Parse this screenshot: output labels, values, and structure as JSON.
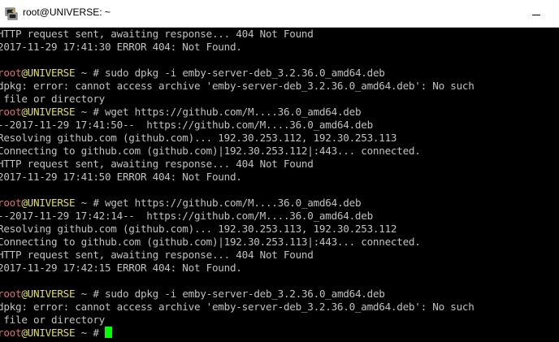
{
  "window": {
    "title": "root@UNIVERSE: ~",
    "icon": "putty-terminal-icon"
  },
  "colors": {
    "background": "#000000",
    "text": "#c0c0c0",
    "prompt_user": "#e06c6c",
    "prompt_host": "#e0e060",
    "cursor": "#00ff00"
  },
  "prompt": {
    "user": "root",
    "host": "@UNIVERSE",
    "suffix": " ~ # "
  },
  "terminal": {
    "lines": [
      {
        "type": "text",
        "text": "HTTP request sent, awaiting response... 404 Not Found"
      },
      {
        "type": "text",
        "text": "2017-11-29 17:41:30 ERROR 404: Not Found."
      },
      {
        "type": "blank",
        "text": ""
      },
      {
        "type": "prompt",
        "command": "sudo dpkg -i emby-server-deb_3.2.36.0_amd64.deb"
      },
      {
        "type": "text",
        "text": "dpkg: error: cannot access archive 'emby-server-deb_3.2.36.0_amd64.deb': No such"
      },
      {
        "type": "text",
        "text": " file or directory"
      },
      {
        "type": "prompt",
        "command": "wget https://github.com/M....36.0_amd64.deb"
      },
      {
        "type": "text",
        "text": "--2017-11-29 17:41:50--  https://github.com/M....36.0_amd64.deb"
      },
      {
        "type": "text",
        "text": "Resolving github.com (github.com)... 192.30.253.112, 192.30.253.113"
      },
      {
        "type": "text",
        "text": "Connecting to github.com (github.com)|192.30.253.112|:443... connected."
      },
      {
        "type": "text",
        "text": "HTTP request sent, awaiting response... 404 Not Found"
      },
      {
        "type": "text",
        "text": "2017-11-29 17:41:50 ERROR 404: Not Found."
      },
      {
        "type": "blank",
        "text": ""
      },
      {
        "type": "prompt",
        "command": "wget https://github.com/M....36.0_amd64.deb"
      },
      {
        "type": "text",
        "text": "--2017-11-29 17:42:14--  https://github.com/M....36.0_amd64.deb"
      },
      {
        "type": "text",
        "text": "Resolving github.com (github.com)... 192.30.253.113, 192.30.253.112"
      },
      {
        "type": "text",
        "text": "Connecting to github.com (github.com)|192.30.253.113|:443... connected."
      },
      {
        "type": "text",
        "text": "HTTP request sent, awaiting response... 404 Not Found"
      },
      {
        "type": "text",
        "text": "2017-11-29 17:42:15 ERROR 404: Not Found."
      },
      {
        "type": "blank",
        "text": ""
      },
      {
        "type": "prompt",
        "command": "sudo dpkg -i emby-server-deb_3.2.36.0_amd64.deb"
      },
      {
        "type": "text",
        "text": "dpkg: error: cannot access archive 'emby-server-deb_3.2.36.0_amd64.deb': No such"
      },
      {
        "type": "text",
        "text": " file or directory"
      },
      {
        "type": "active-prompt",
        "command": ""
      }
    ]
  }
}
